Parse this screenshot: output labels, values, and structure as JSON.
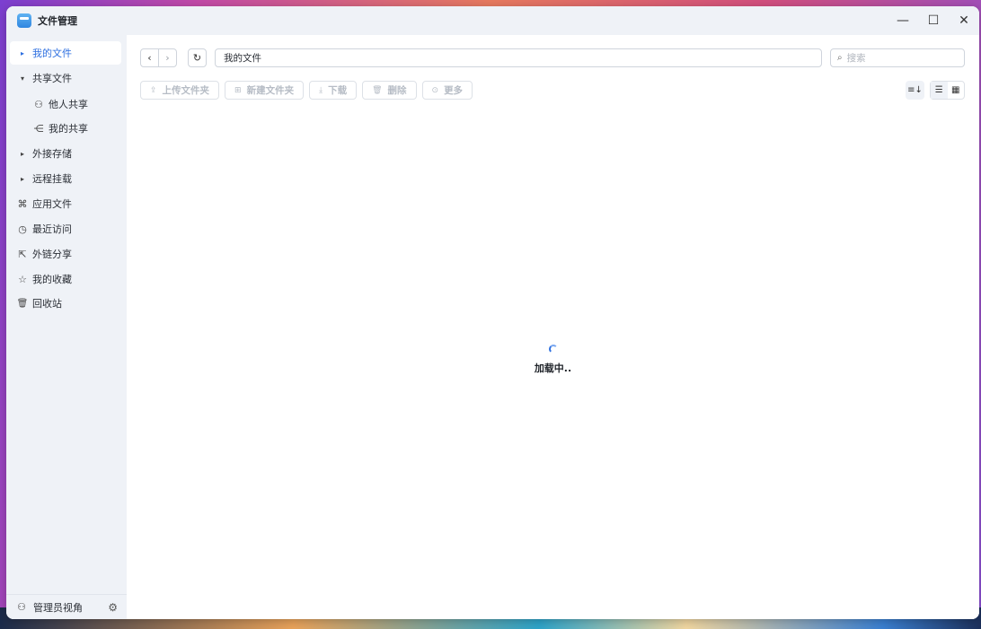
{
  "window": {
    "title": "文件管理",
    "controls": {
      "minimize": "—",
      "maximize": "☐",
      "close": "✕"
    }
  },
  "sidebar": {
    "items": [
      {
        "label": "我的文件",
        "lead": "▸",
        "active": true
      },
      {
        "label": "共享文件",
        "lead": "▾"
      },
      {
        "label": "他人共享",
        "icon": "⚇"
      },
      {
        "label": "我的共享",
        "icon": "⋲"
      },
      {
        "label": "外接存储",
        "lead": "▸"
      },
      {
        "label": "远程挂载",
        "lead": "▸"
      },
      {
        "label": "应用文件",
        "icon": "⌘"
      },
      {
        "label": "最近访问",
        "icon": "◷"
      },
      {
        "label": "外链分享",
        "icon": "⇱"
      },
      {
        "label": "我的收藏",
        "icon": "☆"
      },
      {
        "label": "回收站",
        "icon": "🗑"
      }
    ],
    "footer": {
      "label": "管理员视角",
      "icon": "⚇",
      "gear": "⚙"
    }
  },
  "nav": {
    "back": "‹",
    "forward": "›",
    "refresh": "↻"
  },
  "path": {
    "value": "我的文件"
  },
  "search": {
    "placeholder": "搜索",
    "icon": "⌕"
  },
  "toolbar": {
    "upload": {
      "label": "上传文件夹",
      "icon": "⇪"
    },
    "new_folder": {
      "label": "新建文件夹",
      "icon": "⊞"
    },
    "download": {
      "label": "下载",
      "icon": "⤓"
    },
    "delete": {
      "label": "删除",
      "icon": "🗑"
    },
    "more": {
      "label": "更多",
      "icon": "⊙"
    }
  },
  "view": {
    "sort": "≡↓",
    "list": "☰",
    "grid": "▦"
  },
  "loading": {
    "text": "加载中.."
  }
}
